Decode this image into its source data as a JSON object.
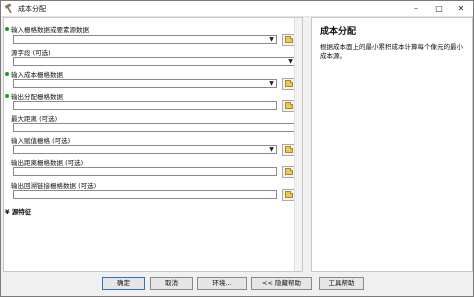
{
  "window": {
    "title": "成本分配",
    "controls": {
      "minimize": "–",
      "maximize": "□",
      "close": "✕"
    }
  },
  "form": {
    "fields": [
      {
        "label": "输入栅格数据或要素源数据",
        "required": true,
        "type": "combo",
        "value": ""
      },
      {
        "label": "源字段 (可选)",
        "required": false,
        "type": "combo",
        "value": ""
      },
      {
        "label": "输入成本栅格数据",
        "required": true,
        "type": "combo",
        "value": ""
      },
      {
        "label": "输出分配栅格数据",
        "required": true,
        "type": "text",
        "value": ""
      },
      {
        "label": "最大距离 (可选)",
        "required": false,
        "type": "text",
        "value": ""
      },
      {
        "label": "输入赋值栅格 (可选)",
        "required": false,
        "type": "combo",
        "value": ""
      },
      {
        "label": "输出距离栅格数据 (可选)",
        "required": false,
        "type": "text",
        "value": ""
      },
      {
        "label": "输出回溯链接栅格数据 (可选)",
        "required": false,
        "type": "text",
        "value": ""
      }
    ],
    "environments_label": "源特征",
    "environments_toggle": "¥"
  },
  "help": {
    "title": "成本分配",
    "body": "根据成本面上的最小累积成本计算每个像元的最小成本源。"
  },
  "buttons": {
    "ok": "确定",
    "cancel": "取消",
    "environments": "环境...",
    "hide_help": "<< 隐藏帮助",
    "tool_help": "工具帮助"
  },
  "colors": {
    "required_dot": "#1aa01a",
    "ok_border": "#2f74c0",
    "folder": "#e9c75a"
  }
}
